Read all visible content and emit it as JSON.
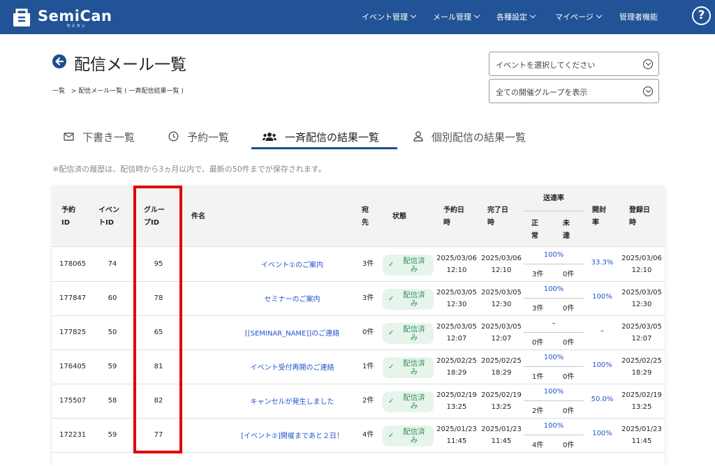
{
  "header": {
    "brand": "SemiCan",
    "brand_sub": "セミカン",
    "nav": [
      "イベント管理",
      "メール管理",
      "各種設定",
      "マイページ",
      "管理者機能"
    ],
    "help": "?"
  },
  "page": {
    "title": "配信メール一覧",
    "breadcrumb_home": "一覧",
    "breadcrumb_current": "> 配信メール一覧 ( 一斉配信結果一覧 )",
    "event_select": "イベントを選択してください",
    "group_select": "全ての開催グループを表示",
    "tabs": [
      "下書き一覧",
      "予約一覧",
      "一斉配信の結果一覧",
      "個別配信の結果一覧"
    ],
    "note": "※配信済の履歴は、配信時から3ヵ月以内で、最新の50件までが保存されます。"
  },
  "table": {
    "headers": {
      "reserve_id_1": "予約",
      "reserve_id_2": "ID",
      "event_id_1": "イベン",
      "event_id_2": "トID",
      "group_id_1": "グルー",
      "group_id_2": "プID",
      "subject": "件名",
      "dest_1": "宛",
      "dest_2": "先",
      "status": "状態",
      "reserved_at_1": "予約日",
      "reserved_at_2": "時",
      "completed_at_1": "完了日",
      "completed_at_2": "時",
      "delivery_rate": "送達率",
      "ok_1": "正",
      "ok_2": "常",
      "ng_1": "未",
      "ng_2": "達",
      "open_rate_1": "開封",
      "open_rate_2": "率",
      "registered_at_1": "登録日",
      "registered_at_2": "時"
    },
    "rows": [
      {
        "reserve_id": "178065",
        "event_id": "74",
        "group_id": "95",
        "subject": "イベント①のご案内",
        "dest": "3件",
        "status_1": "配信済",
        "status_2": "み",
        "reserved_date": "2025/03/06",
        "reserved_time": "12:10",
        "completed_date": "2025/03/06",
        "completed_time": "12:10",
        "rate": "100%",
        "ok": "3件",
        "ng": "0件",
        "open_rate": "33.3%",
        "registered_date": "2025/03/06",
        "registered_time": "12:10"
      },
      {
        "reserve_id": "177847",
        "event_id": "60",
        "group_id": "78",
        "subject": "セミナーのご案内",
        "dest": "3件",
        "status_1": "配信済",
        "status_2": "み",
        "reserved_date": "2025/03/05",
        "reserved_time": "12:30",
        "completed_date": "2025/03/05",
        "completed_time": "12:30",
        "rate": "100%",
        "ok": "3件",
        "ng": "0件",
        "open_rate": "100%",
        "registered_date": "2025/03/05",
        "registered_time": "12:30"
      },
      {
        "reserve_id": "177825",
        "event_id": "50",
        "group_id": "65",
        "subject": "[[SEMINAR_NAME]]のご連絡",
        "dest": "0件",
        "status_1": "配信済",
        "status_2": "み",
        "reserved_date": "2025/03/05",
        "reserved_time": "12:07",
        "completed_date": "2025/03/05",
        "completed_time": "12:07",
        "rate": "–",
        "ok": "0件",
        "ng": "0件",
        "open_rate": "–",
        "registered_date": "2025/03/05",
        "registered_time": "12:07"
      },
      {
        "reserve_id": "176405",
        "event_id": "59",
        "group_id": "81",
        "subject": "イベント受付再開のご連絡",
        "dest": "1件",
        "status_1": "配信済",
        "status_2": "み",
        "reserved_date": "2025/02/25",
        "reserved_time": "18:29",
        "completed_date": "2025/02/25",
        "completed_time": "18:29",
        "rate": "100%",
        "ok": "1件",
        "ng": "0件",
        "open_rate": "100%",
        "registered_date": "2025/02/25",
        "registered_time": "18:29"
      },
      {
        "reserve_id": "175507",
        "event_id": "58",
        "group_id": "82",
        "subject": "キャンセルが発生しました",
        "dest": "2件",
        "status_1": "配信済",
        "status_2": "み",
        "reserved_date": "2025/02/19",
        "reserved_time": "13:25",
        "completed_date": "2025/02/19",
        "completed_time": "13:25",
        "rate": "100%",
        "ok": "2件",
        "ng": "0件",
        "open_rate": "50.0%",
        "registered_date": "2025/02/19",
        "registered_time": "13:25"
      },
      {
        "reserve_id": "172231",
        "event_id": "59",
        "group_id": "77",
        "subject": "[イベント②]開催まであと２日！",
        "dest": "4件",
        "status_1": "配信済",
        "status_2": "み",
        "reserved_date": "2025/01/23",
        "reserved_time": "11:45",
        "completed_date": "2025/01/23",
        "completed_time": "11:45",
        "rate": "100%",
        "ok": "4件",
        "ng": "0件",
        "open_rate": "100%",
        "registered_date": "2025/01/23",
        "registered_time": "11:45"
      }
    ]
  },
  "colors": {
    "header_bg": "#215396",
    "link": "#2255cc",
    "status_bg": "#e6f4ec",
    "status_text": "#2f9158",
    "highlight": "#e00000"
  }
}
